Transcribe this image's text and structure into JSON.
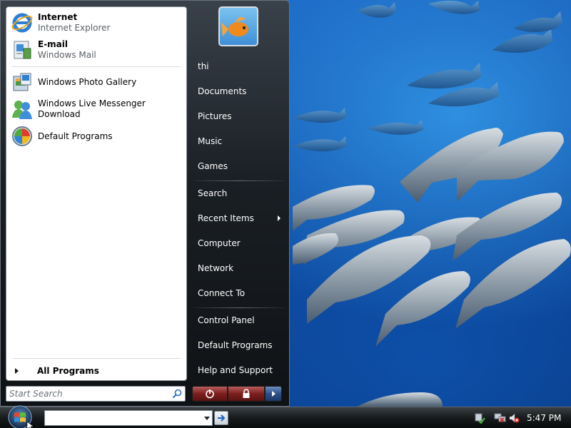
{
  "start_menu": {
    "pinned": [
      {
        "title": "Internet",
        "subtitle": "Internet Explorer",
        "icon": "internet-explorer-icon"
      },
      {
        "title": "E-mail",
        "subtitle": "Windows Mail",
        "icon": "windows-mail-icon"
      }
    ],
    "recent": [
      {
        "title": "Windows Photo Gallery",
        "icon": "photo-gallery-icon"
      },
      {
        "title": "Windows Live Messenger Download",
        "icon": "messenger-icon"
      },
      {
        "title": "Default Programs",
        "icon": "default-programs-icon"
      }
    ],
    "all_programs_label": "All Programs",
    "search_placeholder": "Start Search",
    "right_items": [
      {
        "label": "thi"
      },
      {
        "label": "Documents"
      },
      {
        "label": "Pictures"
      },
      {
        "label": "Music"
      },
      {
        "label": "Games"
      },
      {
        "label": "Search"
      },
      {
        "label": "Recent Items"
      },
      {
        "label": "Computer"
      },
      {
        "label": "Network"
      },
      {
        "label": "Connect To"
      },
      {
        "label": "Control Panel"
      },
      {
        "label": "Default Programs"
      },
      {
        "label": "Help and Support"
      }
    ]
  },
  "taskbar": {
    "run_value": "",
    "clock": "5:47 PM"
  },
  "colors": {
    "menu_dark": "#1a1f24",
    "power_red": "#7c1e1e",
    "power_blue": "#2c4f86",
    "desktop_blue": "#1e6fd0"
  }
}
